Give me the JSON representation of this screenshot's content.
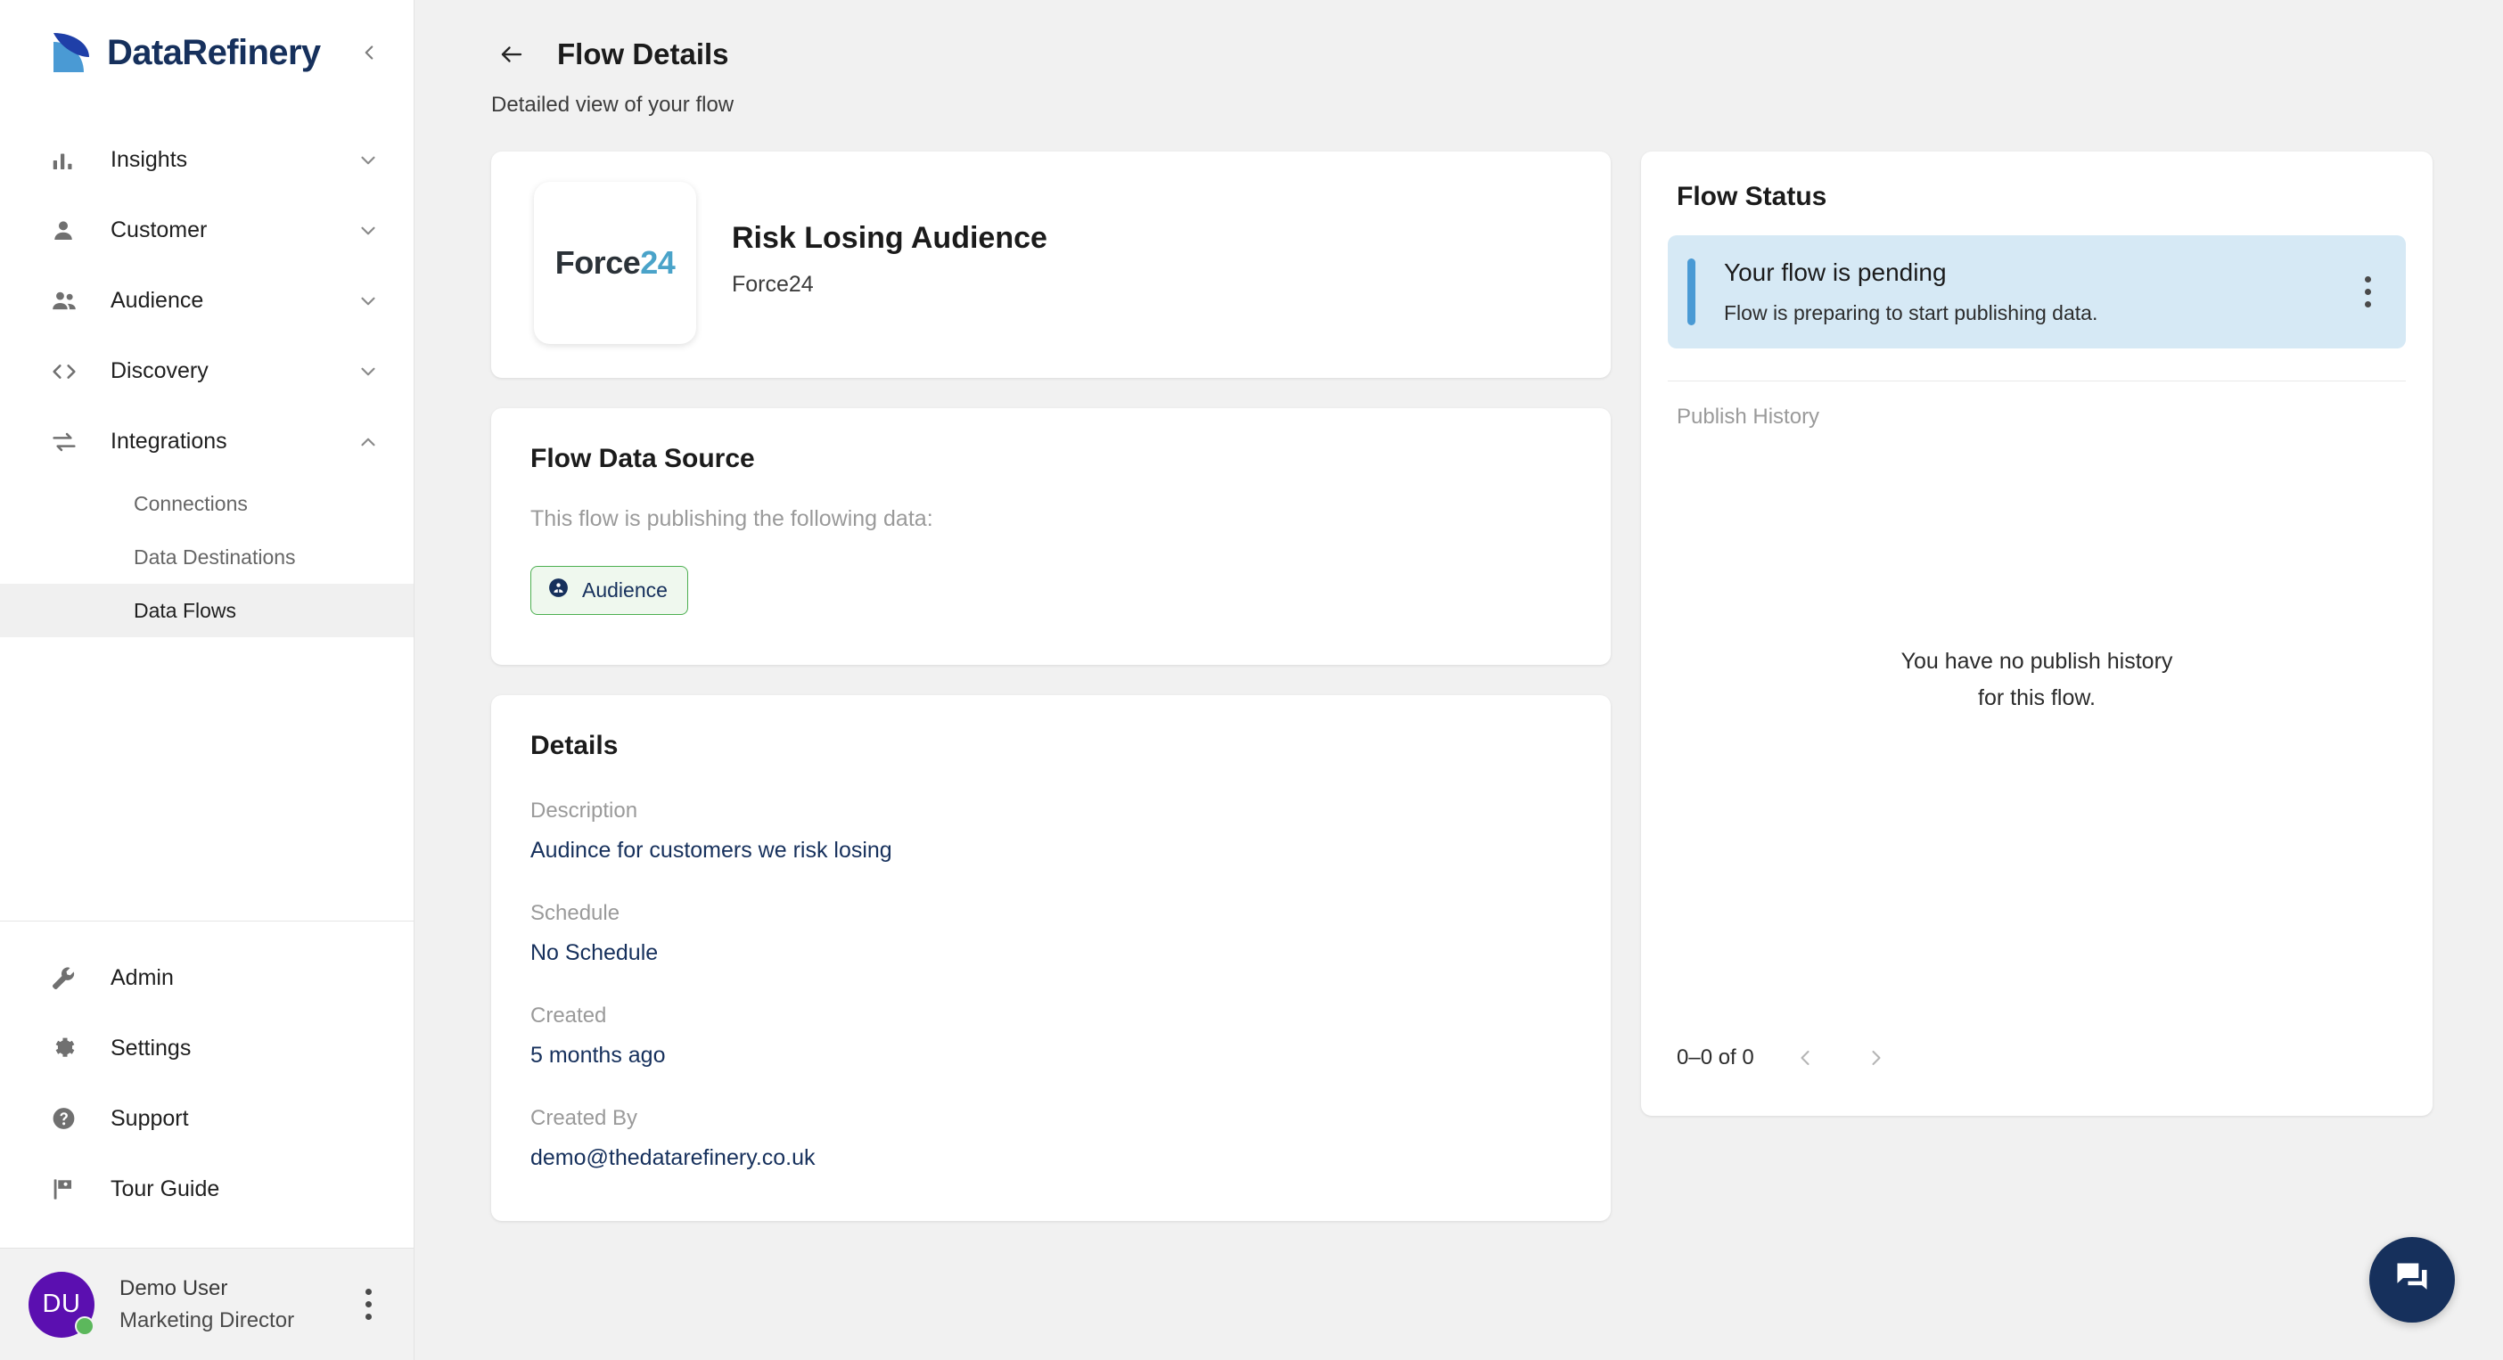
{
  "brand": {
    "name": "DataRefinery",
    "collapse_icon": "chevron-left-icon"
  },
  "sidebar": {
    "items": [
      {
        "label": "Insights",
        "icon": "bar-chart-icon",
        "chevron": "chevron-down-icon"
      },
      {
        "label": "Customer",
        "icon": "person-icon",
        "chevron": "chevron-down-icon"
      },
      {
        "label": "Audience",
        "icon": "people-icon",
        "chevron": "chevron-down-icon"
      },
      {
        "label": "Discovery",
        "icon": "code-brackets-icon",
        "chevron": "chevron-down-icon"
      },
      {
        "label": "Integrations",
        "icon": "sync-arrows-icon",
        "chevron": "chevron-up-icon"
      }
    ],
    "sub_items": [
      {
        "label": "Connections",
        "active": false
      },
      {
        "label": "Data Destinations",
        "active": false
      },
      {
        "label": "Data Flows",
        "active": true
      }
    ],
    "bottom_items": [
      {
        "label": "Admin",
        "icon": "wrench-icon"
      },
      {
        "label": "Settings",
        "icon": "gear-icon"
      },
      {
        "label": "Support",
        "icon": "help-circle-icon"
      },
      {
        "label": "Tour Guide",
        "icon": "flag-icon"
      }
    ],
    "user": {
      "initials": "DU",
      "name": "Demo User",
      "role": "Marketing Director",
      "status_color": "#5cb85c",
      "avatar_color": "#5b0fb0",
      "menu_icon": "kebab-menu-icon"
    }
  },
  "header": {
    "back_icon": "arrow-left-icon",
    "title": "Flow Details",
    "subtitle": "Detailed view of your flow"
  },
  "flow": {
    "logo_primary": "Force",
    "logo_accent": "24",
    "title": "Risk Losing Audience",
    "vendor": "Force24"
  },
  "data_source": {
    "heading": "Flow Data Source",
    "subtitle": "This flow is publishing the following data:",
    "chip": {
      "label": "Audience",
      "icon": "audience-circle-icon",
      "border_color": "#4caf50",
      "bg_color": "#eff8ee",
      "text_color": "#16305c"
    }
  },
  "details": {
    "heading": "Details",
    "fields": [
      {
        "label": "Description",
        "value": "Audince for customers we risk losing"
      },
      {
        "label": "Schedule",
        "value": "No Schedule"
      },
      {
        "label": "Created",
        "value": "5 months ago"
      },
      {
        "label": "Created By",
        "value": "demo@thedatarefinery.co.uk"
      }
    ]
  },
  "status": {
    "heading": "Flow Status",
    "alert": {
      "title": "Your flow is pending",
      "description": "Flow is preparing to start publishing data.",
      "accent_color": "#4a9ad4",
      "bg_color": "#d6e9f5",
      "menu_icon": "kebab-menu-icon"
    },
    "publish_history_label": "Publish History",
    "empty_line1": "You have no publish history",
    "empty_line2": "for this flow.",
    "pager": {
      "count": "0–0 of 0",
      "prev_icon": "chevron-left-icon",
      "next_icon": "chevron-right-icon"
    }
  },
  "fab": {
    "icon": "chat-bubble-icon",
    "color": "#16305c"
  }
}
